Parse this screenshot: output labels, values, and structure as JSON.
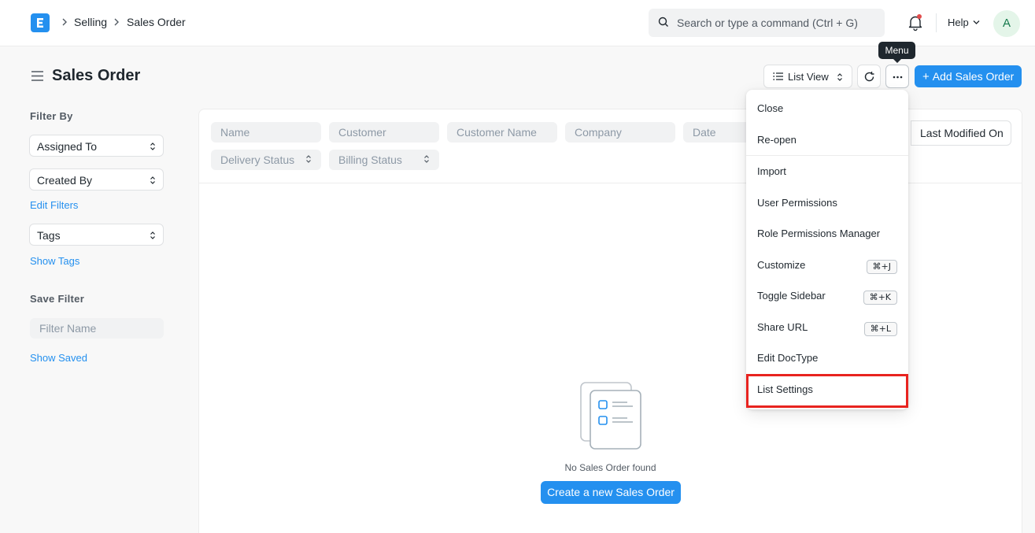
{
  "navbar": {
    "breadcrumbs": [
      "Selling",
      "Sales Order"
    ],
    "search_placeholder": "Search or type a command (Ctrl + G)",
    "help_label": "Help",
    "avatar_initial": "A"
  },
  "page": {
    "title": "Sales Order",
    "list_view_label": "List View",
    "menu_tooltip": "Menu",
    "add_button_plus": "+",
    "add_button_label": "Add Sales Order"
  },
  "sidebar": {
    "filter_by_heading": "Filter By",
    "assigned_to": "Assigned To",
    "created_by": "Created By",
    "edit_filters": "Edit Filters",
    "tags": "Tags",
    "show_tags": "Show Tags",
    "save_filter_heading": "Save Filter",
    "filter_name_placeholder": "Filter Name",
    "show_saved": "Show Saved"
  },
  "filters": {
    "name": "Name",
    "customer": "Customer",
    "customer_name": "Customer Name",
    "company": "Company",
    "date": "Date",
    "delivery_status": "Delivery Status",
    "billing_status": "Billing Status",
    "sort_label": "Last Modified On"
  },
  "empty_state": {
    "message": "No Sales Order found",
    "create_label": "Create a new Sales Order"
  },
  "menu": {
    "items": [
      {
        "label": "Close",
        "shortcut": ""
      },
      {
        "label": "Re-open",
        "shortcut": ""
      },
      {
        "label": "Import",
        "shortcut": ""
      },
      {
        "label": "User Permissions",
        "shortcut": ""
      },
      {
        "label": "Role Permissions Manager",
        "shortcut": ""
      },
      {
        "label": "Customize",
        "shortcut": "⌘+J"
      },
      {
        "label": "Toggle Sidebar",
        "shortcut": "⌘+K"
      },
      {
        "label": "Share URL",
        "shortcut": "⌘+L"
      },
      {
        "label": "Edit DocType",
        "shortcut": ""
      },
      {
        "label": "List Settings",
        "shortcut": ""
      }
    ]
  },
  "colors": {
    "primary": "#2490ef",
    "highlight": "#e8231f",
    "text": "#1f272e"
  }
}
